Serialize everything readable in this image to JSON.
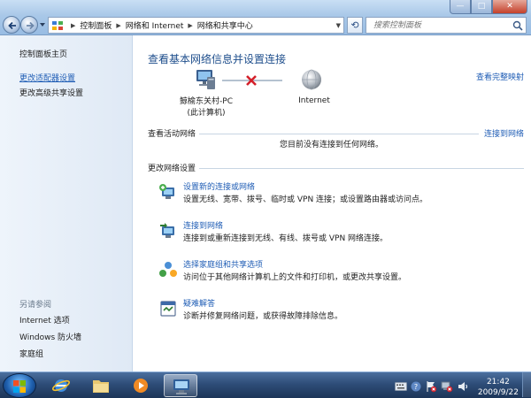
{
  "window": {
    "minimize_label": "—",
    "maximize_label": "□",
    "close_label": "✕"
  },
  "address": {
    "crumbs": [
      "控制面板",
      "网络和 Internet",
      "网络和共享中心"
    ],
    "search_placeholder": "搜索控制面板"
  },
  "sidebar": {
    "items": [
      {
        "label": "控制面板主页"
      },
      {
        "label": "更改适配器设置"
      },
      {
        "label": "更改高级共享设置"
      }
    ],
    "see_also_header": "另请参阅",
    "see_also": [
      {
        "label": "Internet 选项"
      },
      {
        "label": "Windows 防火墙"
      },
      {
        "label": "家庭组"
      }
    ]
  },
  "main": {
    "title": "查看基本网络信息并设置连接",
    "full_map_link": "查看完整映射",
    "pc_name": "鲸榆东关村-PC",
    "pc_sub": "(此计算机)",
    "internet_label": "Internet",
    "active_networks_header": "查看活动网络",
    "no_connection_text": "您目前没有连接到任何网络。",
    "connect_link": "连接到网络",
    "change_settings_header": "更改网络设置",
    "tasks": [
      {
        "icon": "new-connection-icon",
        "link": "设置新的连接或网络",
        "desc": "设置无线、宽带、拨号、临时或 VPN 连接；或设置路由器或访问点。"
      },
      {
        "icon": "connect-network-icon",
        "link": "连接到网络",
        "desc": "连接到或重新连接到无线、有线、拨号或 VPN 网络连接。"
      },
      {
        "icon": "homegroup-icon",
        "link": "选择家庭组和共享选项",
        "desc": "访问位于其他网络计算机上的文件和打印机，或更改共享设置。"
      },
      {
        "icon": "troubleshoot-icon",
        "link": "疑难解答",
        "desc": "诊断并修复网络问题，或获得故障排除信息。"
      }
    ]
  },
  "taskbar": {
    "time": "21:42",
    "date": "2009/9/22"
  },
  "colors": {
    "link": "#1f5db5",
    "title": "#1e4e8c",
    "error_x": "#d4202a"
  }
}
